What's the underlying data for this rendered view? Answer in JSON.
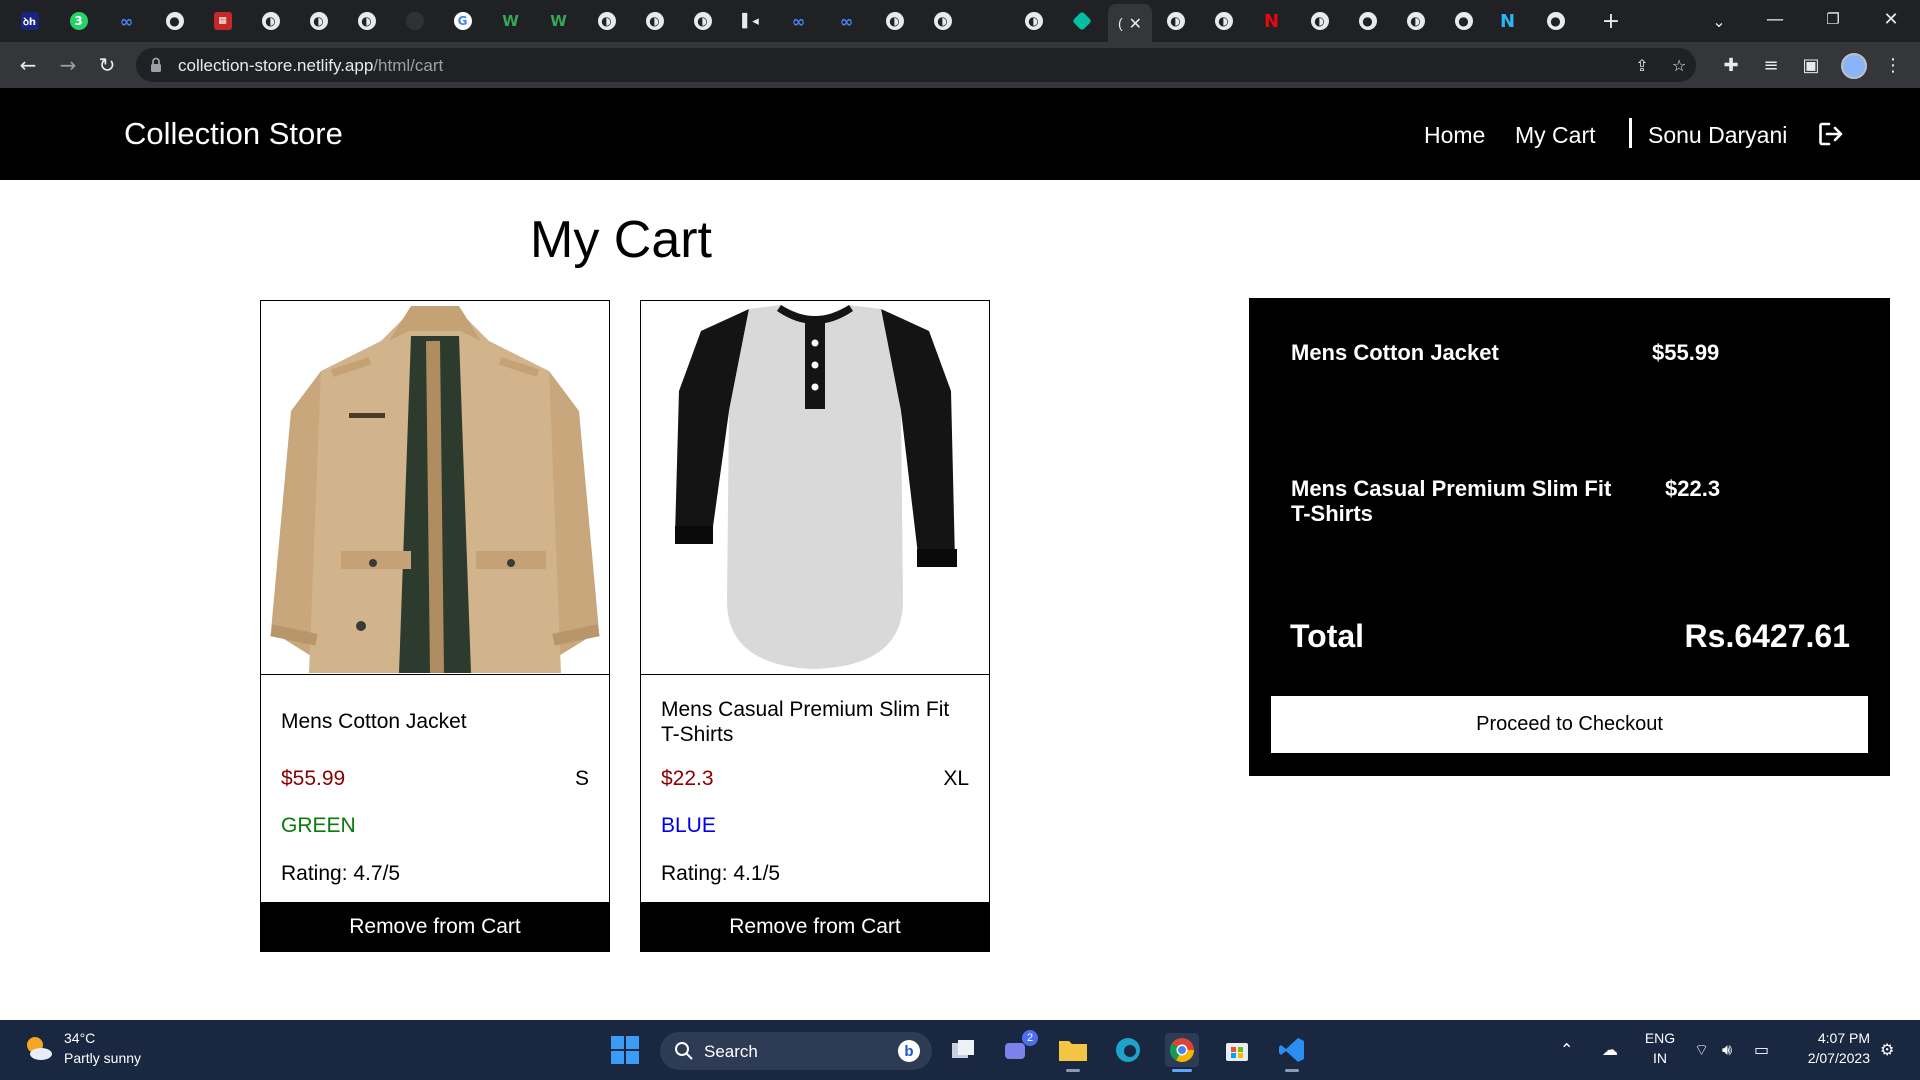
{
  "browser": {
    "url_host": "collection-store.netlify.app",
    "url_path": "/html/cart"
  },
  "navbar": {
    "brand": "Collection Store",
    "links": [
      "Home",
      "My Cart"
    ],
    "user": "Sonu Daryani"
  },
  "page": {
    "title": "My Cart"
  },
  "cart_items": [
    {
      "name": "Mens Cotton Jacket",
      "price": "$55.99",
      "size": "S",
      "color": "GREEN",
      "color_hex": "#0a7a0a",
      "rating": "Rating: 4.7/5",
      "remove_label": "Remove from Cart"
    },
    {
      "name": "Mens Casual Premium Slim Fit T-Shirts",
      "price": "$22.3",
      "size": "XL",
      "color": "BLUE",
      "color_hex": "#0000ee",
      "rating": "Rating: 4.1/5",
      "remove_label": "Remove from Cart"
    }
  ],
  "summary": {
    "items": [
      {
        "name": "Mens Cotton Jacket",
        "price": "$55.99"
      },
      {
        "name": "Mens Casual Premium Slim Fit T-Shirts",
        "price": "$22.3"
      }
    ],
    "total_label": "Total",
    "total_value": "Rs.6427.61",
    "checkout_label": "Proceed to Checkout"
  },
  "taskbar": {
    "weather_temp": "34°C",
    "weather_desc": "Partly sunny",
    "search_label": "Search",
    "teams_badge": "2",
    "lang_top": "ENG",
    "lang_bottom": "IN",
    "time": "4:07 PM",
    "date": "2/07/2023"
  },
  "colors": {
    "price": "#8b0000",
    "navbar_bg": "#000000",
    "accent_blue": "#60a5fa"
  }
}
